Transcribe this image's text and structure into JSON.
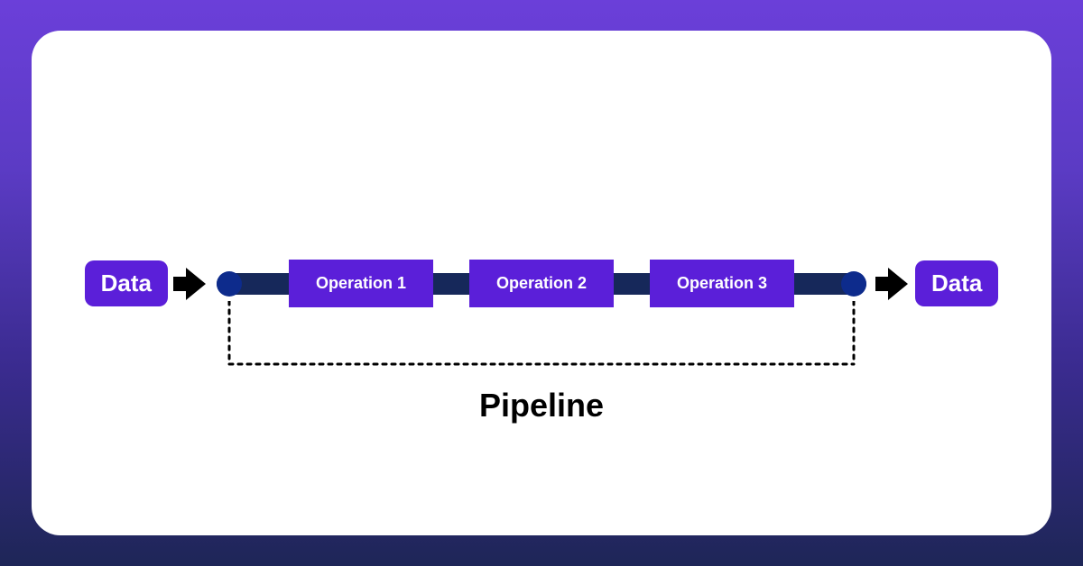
{
  "input": {
    "label": "Data"
  },
  "output": {
    "label": "Data"
  },
  "operations": [
    {
      "label": "Operation 1"
    },
    {
      "label": "Operation 2"
    },
    {
      "label": "Operation 3"
    }
  ],
  "caption": "Pipeline",
  "colors": {
    "box": "#5B1FD9",
    "track": "#16285A",
    "cap": "#0D2B8C"
  }
}
